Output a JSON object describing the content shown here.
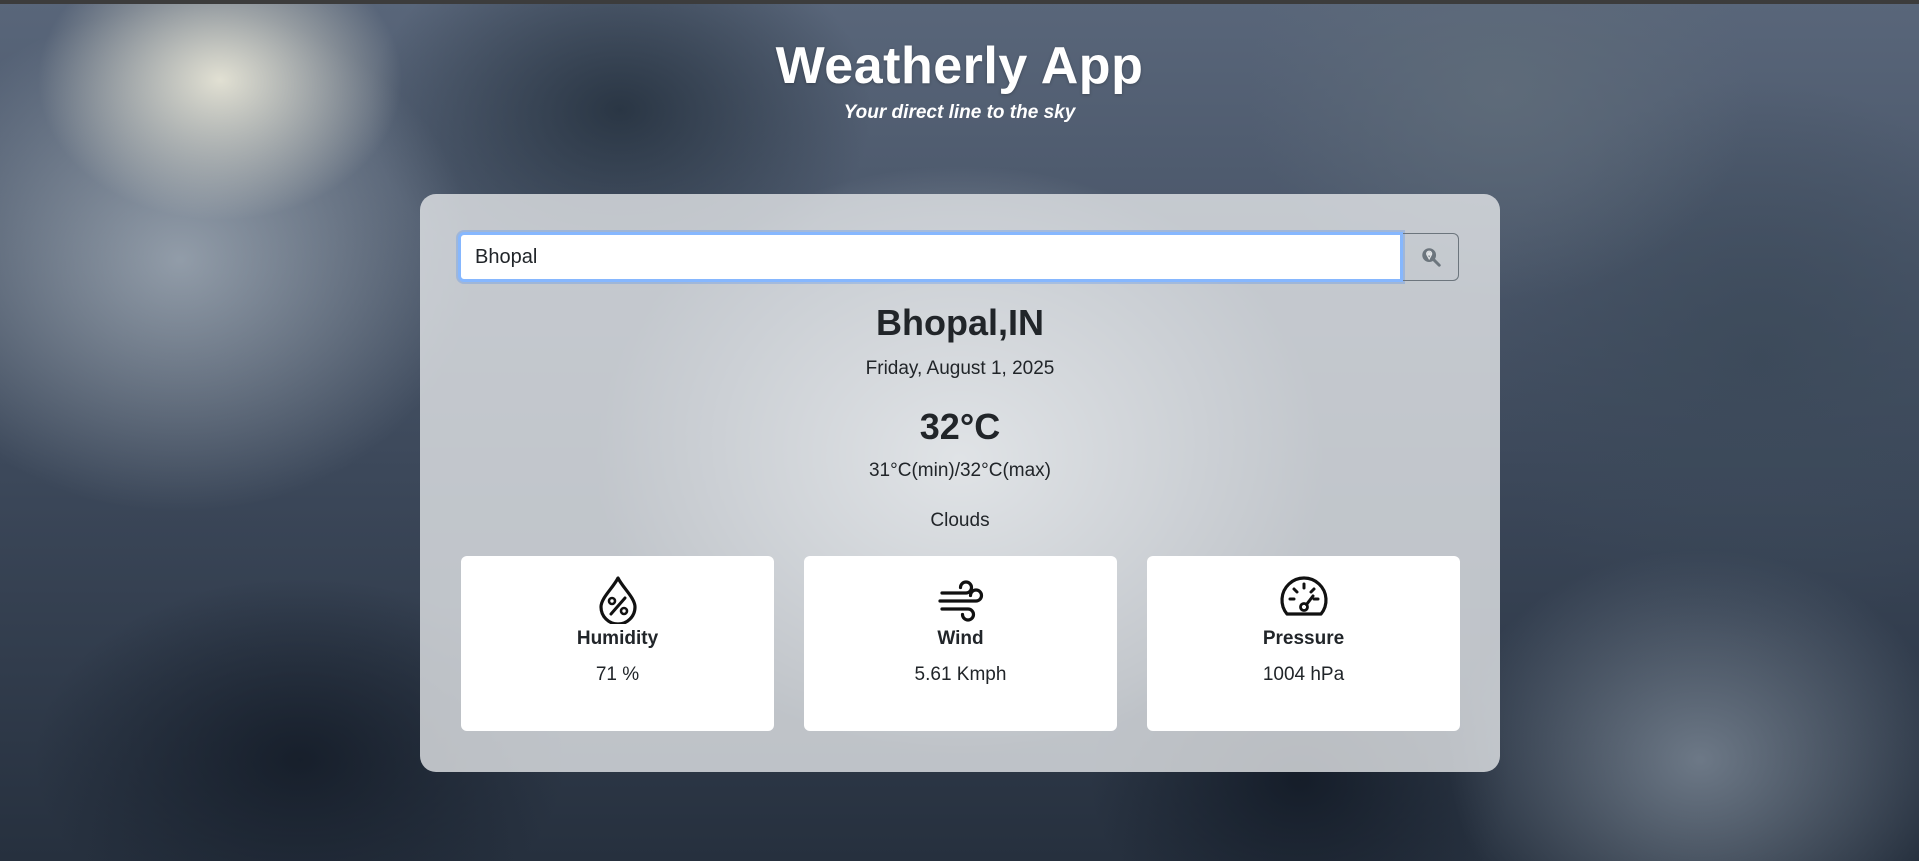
{
  "header": {
    "title": "Weatherly App",
    "subtitle": "Your direct line to the sky"
  },
  "search": {
    "value": "Bhopal",
    "button_icon": "search-location-icon"
  },
  "weather": {
    "city": "Bhopal,IN",
    "date": "Friday, August 1, 2025",
    "temperature": "32°C",
    "minmax": "31°C(min)/32°C(max)",
    "condition": "Clouds"
  },
  "stats": [
    {
      "label": "Humidity",
      "value": "71 %",
      "icon": "humidity-drop-icon"
    },
    {
      "label": "Wind",
      "value": "5.61 Kmph",
      "icon": "wind-icon"
    },
    {
      "label": "Pressure",
      "value": "1004 hPa",
      "icon": "gauge-icon"
    }
  ],
  "colors": {
    "input_focus_border": "#86b7fe",
    "text": "#212529",
    "card_bg": "rgba(228,230,232,0.8)"
  }
}
